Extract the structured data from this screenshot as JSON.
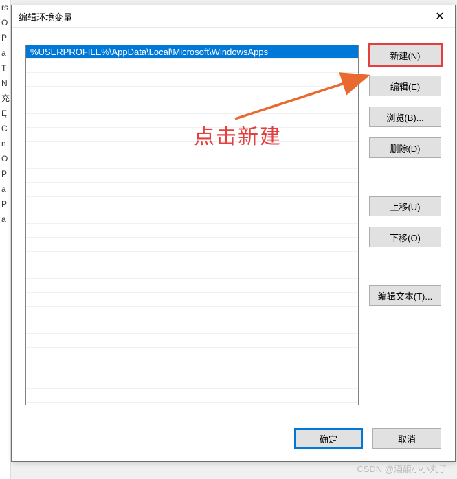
{
  "dialog": {
    "title": "编辑环境变量",
    "close_label": "✕"
  },
  "list": {
    "items": [
      "%USERPROFILE%\\AppData\\Local\\Microsoft\\WindowsApps"
    ],
    "selected_index": 0
  },
  "buttons": {
    "new": "新建(N)",
    "edit": "编辑(E)",
    "browse": "浏览(B)...",
    "delete": "删除(D)",
    "move_up": "上移(U)",
    "move_down": "下移(O)",
    "edit_text": "编辑文本(T)...",
    "ok": "确定",
    "cancel": "取消"
  },
  "annotation": {
    "text": "点击新建",
    "highlight_button": "new"
  },
  "background_fragments": [
    "rs",
    "O",
    "P",
    "a",
    "T",
    "N",
    "",
    "",
    "",
    "",
    "",
    "",
    "",
    "",
    "",
    "",
    "充",
    "",
    "Ę",
    "C",
    "n",
    "O",
    "P",
    "a",
    "P",
    "a"
  ],
  "watermark": "CSDN @酒酿小小丸子"
}
